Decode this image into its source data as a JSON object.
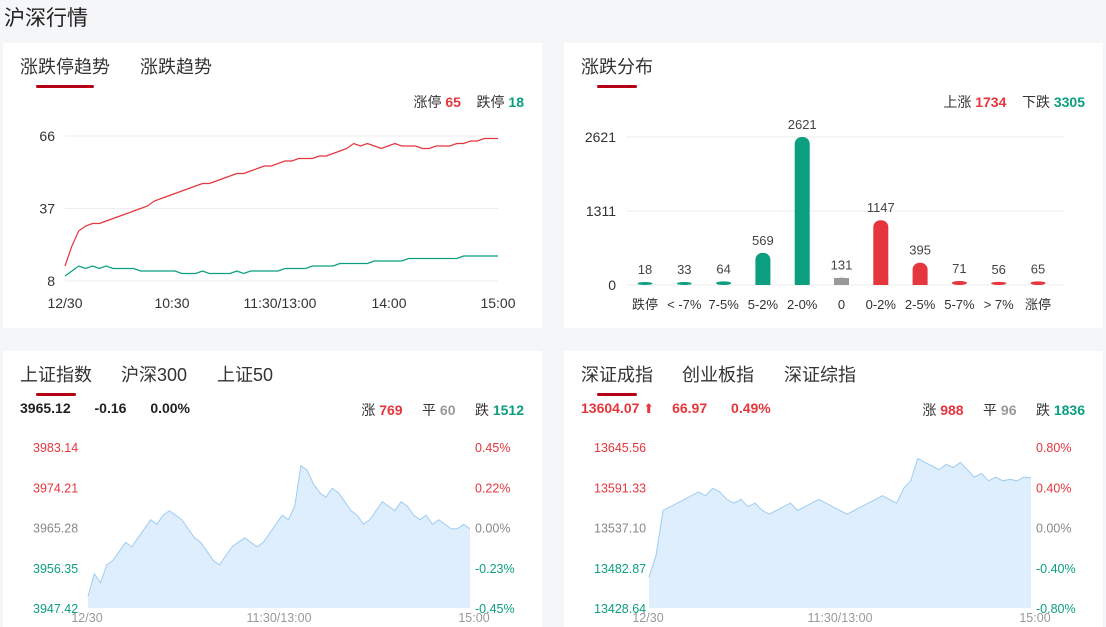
{
  "page_title": "沪深行情",
  "colors": {
    "up": "#e5363d",
    "down": "#0b9f80",
    "flat": "#999999",
    "accent": "#b50016",
    "area": "#deeefc",
    "area_line": "#9fcdf3"
  },
  "limit_panel": {
    "tabs": [
      "涨跌停趋势",
      "涨跌趋势"
    ],
    "active_tab": 0,
    "legend": {
      "up_label": "涨停",
      "up_value": "65",
      "down_label": "跌停",
      "down_value": "18"
    },
    "chart_data": {
      "type": "line",
      "x_ticks": [
        "12/30",
        "10:30",
        "11:30/13:00",
        "14:00",
        "15:00"
      ],
      "y_ticks": [
        "66",
        "37",
        "8"
      ],
      "ylim": [
        8,
        66
      ],
      "series": [
        {
          "name": "涨停",
          "values": [
            14,
            22,
            28,
            30,
            31,
            31,
            32,
            33,
            34,
            35,
            36,
            37,
            38,
            40,
            41,
            42,
            43,
            44,
            45,
            46,
            47,
            47,
            48,
            49,
            50,
            51,
            51,
            52,
            53,
            54,
            54,
            55,
            56,
            56,
            57,
            57,
            57,
            58,
            58,
            59,
            60,
            61,
            63,
            62,
            63,
            62,
            61,
            62,
            63,
            62,
            62,
            62,
            61,
            61,
            62,
            62,
            62,
            63,
            63,
            64,
            64,
            65,
            65,
            65
          ]
        },
        {
          "name": "跌停",
          "values": [
            10,
            12,
            14,
            13,
            14,
            13,
            14,
            13,
            13,
            13,
            13,
            12,
            12,
            12,
            12,
            12,
            12,
            11,
            11,
            11,
            12,
            11,
            11,
            11,
            11,
            12,
            11,
            12,
            12,
            12,
            12,
            12,
            13,
            13,
            13,
            13,
            14,
            14,
            14,
            14,
            15,
            15,
            15,
            15,
            15,
            16,
            16,
            16,
            16,
            16,
            17,
            17,
            17,
            17,
            17,
            17,
            17,
            17,
            18,
            18,
            18,
            18,
            18,
            18
          ]
        }
      ]
    }
  },
  "dist_panel": {
    "tabs": [
      "涨跌分布"
    ],
    "active_tab": 0,
    "legend": {
      "up_label": "上涨",
      "up_value": "1734",
      "down_label": "下跌",
      "down_value": "3305"
    },
    "chart_data": {
      "type": "bar",
      "categories": [
        "跌停",
        "< -7%",
        "7-5%",
        "5-2%",
        "2-0%",
        "0",
        "0-2%",
        "2-5%",
        "5-7%",
        "> 7%",
        "涨停"
      ],
      "values": [
        18,
        33,
        64,
        569,
        2621,
        131,
        1147,
        395,
        71,
        56,
        65
      ],
      "bar_colors": [
        "down",
        "down",
        "down",
        "down",
        "down",
        "flat",
        "up",
        "up",
        "up",
        "up",
        "up"
      ],
      "y_ticks": [
        "2621",
        "1311",
        "0"
      ],
      "ylim": [
        0,
        2621
      ]
    }
  },
  "sh_panel": {
    "tabs": [
      "上证指数",
      "沪深300",
      "上证50"
    ],
    "active_tab": 0,
    "price": "3965.12",
    "change": "-0.16",
    "change_pct": "0.00%",
    "stats": {
      "up_label": "涨",
      "up_value": "769",
      "flat_label": "平",
      "flat_value": "60",
      "down_label": "跌",
      "down_value": "1512"
    },
    "chart_data": {
      "type": "area",
      "x_ticks": [
        "12/30",
        "11:30/13:00",
        "15:00"
      ],
      "y_ticks_left": [
        "3983.14",
        "3974.21",
        "3965.28",
        "3956.35",
        "3947.42"
      ],
      "y_ticks_right": [
        "0.45%",
        "0.22%",
        "0.00%",
        "-0.23%",
        "-0.45%"
      ],
      "ylim": [
        3947.42,
        3983.14
      ],
      "values": [
        3950,
        3955,
        3953,
        3957,
        3958,
        3960,
        3962,
        3961,
        3963,
        3965,
        3967,
        3966,
        3968,
        3969,
        3968,
        3967,
        3965,
        3963,
        3962,
        3960,
        3958,
        3957,
        3959,
        3961,
        3962,
        3963,
        3962,
        3961,
        3962,
        3964,
        3966,
        3968,
        3967,
        3970,
        3979,
        3978,
        3975,
        3973,
        3972,
        3974,
        3973,
        3971,
        3969,
        3968,
        3966,
        3967,
        3969,
        3971,
        3970,
        3969,
        3971,
        3970,
        3968,
        3967,
        3968,
        3966,
        3967,
        3966,
        3965,
        3965,
        3966,
        3965
      ]
    }
  },
  "sz_panel": {
    "tabs": [
      "深证成指",
      "创业板指",
      "深证综指"
    ],
    "active_tab": 0,
    "price": "13604.07",
    "change": "66.97",
    "change_pct": "0.49%",
    "stats": {
      "up_label": "涨",
      "up_value": "988",
      "flat_label": "平",
      "flat_value": "96",
      "down_label": "跌",
      "down_value": "1836"
    },
    "chart_data": {
      "type": "area",
      "x_ticks": [
        "12/30",
        "11:30/13:00",
        "15:00"
      ],
      "y_ticks_left": [
        "13645.56",
        "13591.33",
        "13537.10",
        "13482.87",
        "13428.64"
      ],
      "y_ticks_right": [
        "0.80%",
        "0.40%",
        "0.00%",
        "-0.40%",
        "-0.80%"
      ],
      "ylim": [
        13428.64,
        13645.56
      ],
      "values": [
        13470,
        13500,
        13560,
        13565,
        13570,
        13575,
        13580,
        13585,
        13580,
        13590,
        13585,
        13575,
        13570,
        13575,
        13565,
        13570,
        13560,
        13555,
        13560,
        13565,
        13570,
        13560,
        13565,
        13570,
        13575,
        13570,
        13565,
        13560,
        13555,
        13560,
        13565,
        13570,
        13575,
        13580,
        13575,
        13570,
        13590,
        13600,
        13630,
        13625,
        13620,
        13615,
        13622,
        13618,
        13625,
        13615,
        13605,
        13610,
        13600,
        13605,
        13600,
        13602,
        13600,
        13605,
        13604
      ]
    }
  }
}
